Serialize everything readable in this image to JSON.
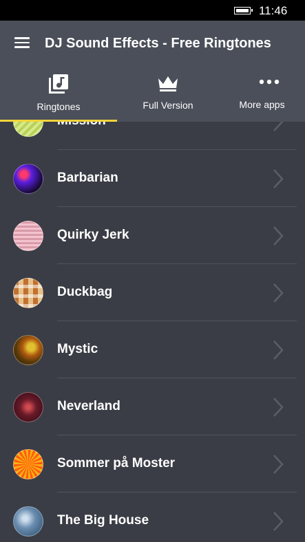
{
  "status_bar": {
    "time": "11:46"
  },
  "header": {
    "title": "DJ Sound Effects - Free Ringtones"
  },
  "tabs": [
    {
      "label": "Ringtones",
      "icon": "music-library-icon",
      "selected": true
    },
    {
      "label": "Full Version",
      "icon": "crown-icon",
      "selected": false
    },
    {
      "label": "More apps",
      "icon": "more-dots-icon",
      "selected": false
    }
  ],
  "colors": {
    "accent": "#f3d43a",
    "header": "#4b4f59",
    "background": "#3a3d45"
  },
  "ringtones": [
    {
      "name": "Mission"
    },
    {
      "name": "Barbarian"
    },
    {
      "name": "Quirky Jerk"
    },
    {
      "name": "Duckbag"
    },
    {
      "name": "Mystic"
    },
    {
      "name": "Neverland"
    },
    {
      "name": "Sommer på Moster"
    },
    {
      "name": "The Big House"
    }
  ]
}
